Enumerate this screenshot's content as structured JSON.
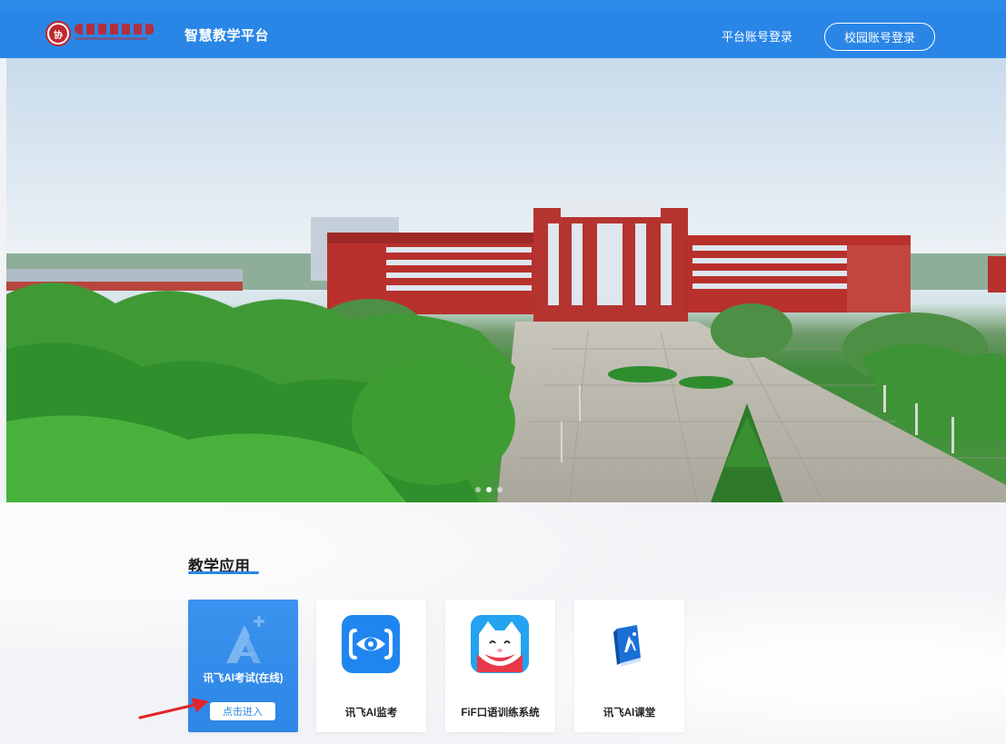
{
  "header": {
    "logo_text": "山东协和学院",
    "platform_title": "智慧教学平台",
    "platform_login": "平台账号登录",
    "campus_login": "校园账号登录"
  },
  "banner": {
    "slide_count": 3,
    "active_slide": 2
  },
  "section": {
    "title": "教学应用"
  },
  "apps": [
    {
      "label": "讯飞AI考试(在线)",
      "action": "点击进入",
      "icon": "ai-exam-icon",
      "active": true
    },
    {
      "label": "讯飞AI监考",
      "icon": "eye-monitor-icon"
    },
    {
      "label": "FiF口语训练系统",
      "icon": "cat-mascot-icon"
    },
    {
      "label": "讯飞AI课堂",
      "icon": "book-ai-icon"
    }
  ],
  "colors": {
    "brand_blue": "#2a86e6",
    "logo_red": "#c0272d",
    "arrow_red": "#e0262c"
  }
}
